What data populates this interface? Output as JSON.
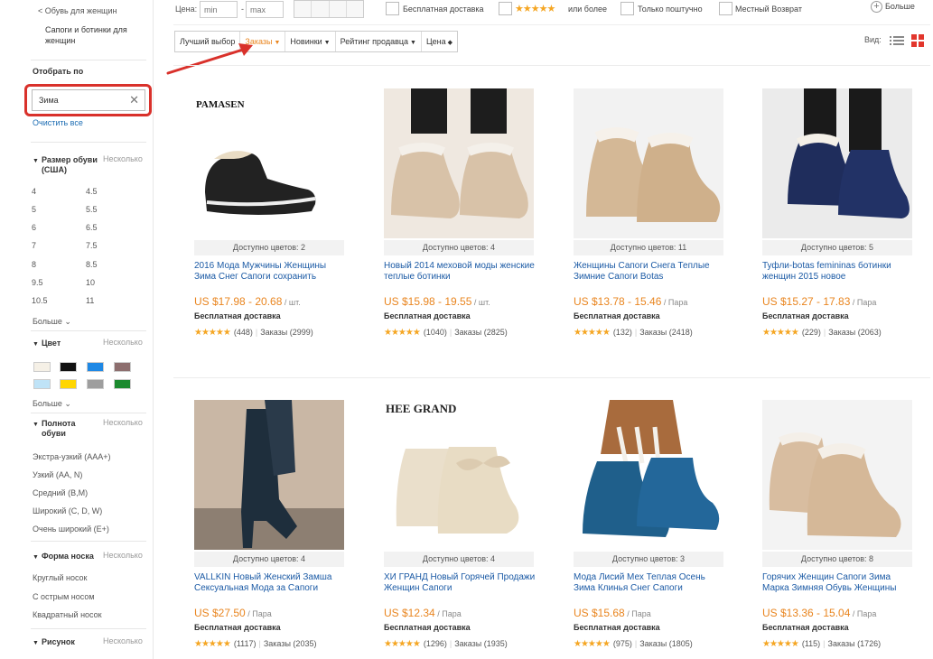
{
  "sidebar": {
    "back_link": "< Обувь для женщин",
    "category": "Сапоги и ботинки для женщин",
    "filter_title": "Отобрать по",
    "search_value": "Зима",
    "clear_all": "Очистить все",
    "multi_label": "Несколько",
    "size_section": "Размер обуви (США)",
    "sizes_left": [
      "4",
      "5",
      "6",
      "7",
      "8",
      "9.5",
      "10.5"
    ],
    "sizes_right": [
      "4.5",
      "5.5",
      "6.5",
      "7.5",
      "8.5",
      "10",
      "11"
    ],
    "more": "Больше",
    "color_section": "Цвет",
    "colors": [
      "#f5f0e6",
      "#111111",
      "#1e88e5",
      "#8d6e6e",
      "#bfe3f7",
      "#ffd600",
      "#9e9e9e",
      "#1b8a2e"
    ],
    "width_section": "Полнота обуви",
    "widths": [
      "Экстра-узкий (AAA+)",
      "Узкий (AA, N)",
      "Средний (B,M)",
      "Широкий (C, D, W)",
      "Очень широкий (E+)"
    ],
    "toe_section": "Форма носка",
    "toes": [
      "Круглый носок",
      "С острым носом",
      "Квадратный носок"
    ],
    "pattern_section": "Рисунок"
  },
  "topbar": {
    "price_label": "Цена:",
    "min_placeholder": "min",
    "max_placeholder": "max",
    "free_shipping": "Бесплатная доставка",
    "rating_or_more": "или более",
    "single_only": "Только поштучно",
    "local_return": "Местный Возврат",
    "more": "Больше"
  },
  "sort": {
    "items": [
      {
        "label": "Лучший выбор"
      },
      {
        "label": "Заказы"
      },
      {
        "label": "Новинки"
      },
      {
        "label": "Рейтинг продавца"
      },
      {
        "label": "Цена"
      }
    ],
    "view_label": "Вид:"
  },
  "products": [
    {
      "colors": "Доступно цветов: 2",
      "title": "2016 Мода Мужчины Женщины Зима Снег Сапоги сохранить",
      "price": "US $17.98 - 20.68",
      "unit": " / шт.",
      "shipping": "Бесплатная доставка",
      "reviews": "(448)",
      "orders": "Заказы (2999)",
      "brand": "PAMASEN"
    },
    {
      "colors": "Доступно цветов: 4",
      "title": "Новый 2014 меховой моды женские теплые ботинки",
      "price": "US $15.98 - 19.55",
      "unit": " / шт.",
      "shipping": "Бесплатная доставка",
      "reviews": "(1040)",
      "orders": "Заказы (2825)",
      "brand": ""
    },
    {
      "colors": "Доступно цветов: 11",
      "title": "Женщины Сапоги Снега Теплые Зимние Сапоги Botas",
      "price": "US $13.78 - 15.46",
      "unit": " / Пара",
      "shipping": "Бесплатная доставка",
      "reviews": "(132)",
      "orders": "Заказы (2418)",
      "brand": ""
    },
    {
      "colors": "Доступно цветов: 5",
      "title": "Туфли-botas femininas ботинки женщин 2015 новое",
      "price": "US $15.27 - 17.83",
      "unit": " / Пара",
      "shipping": "Бесплатная доставка",
      "reviews": "(229)",
      "orders": "Заказы (2063)",
      "brand": ""
    },
    {
      "colors": "Доступно цветов: 4",
      "title": "VALLKIN Новый Женский Замша Сексуальная Мода за Сапоги",
      "price": "US $27.50",
      "unit": " / Пара",
      "shipping": "Бесплатная доставка",
      "reviews": "(1117)",
      "orders": "Заказы (2035)",
      "brand": ""
    },
    {
      "colors": "Доступно цветов: 4",
      "title": "ХИ ГРАНД Новый Горячей Продажи Женщин Сапоги",
      "price": "US $12.34",
      "unit": " / Пара",
      "shipping": "Бесплатная доставка",
      "reviews": "(1296)",
      "orders": "Заказы (1935)",
      "brand": "HEE GRAND"
    },
    {
      "colors": "Доступно цветов: 3",
      "title": "Мода Лисий Мех Теплая Осень Зима Клинья Снег Сапоги",
      "price": "US $15.68",
      "unit": " / Пара",
      "shipping": "Бесплатная доставка",
      "reviews": "(975)",
      "orders": "Заказы (1805)",
      "brand": ""
    },
    {
      "colors": "Доступно цветов: 8",
      "title": "Горячих Женщин Сапоги Зима Марка Зимняя Обувь Женщины",
      "price": "US $13.36 - 15.04",
      "unit": " / Пара",
      "shipping": "Бесплатная доставка",
      "reviews": "(115)",
      "orders": "Заказы (1726)",
      "brand": ""
    }
  ],
  "stars": "★★★★★",
  "accent": "#e9851f",
  "link_color": "#1b5aa5",
  "highlight_color": "#d9312b"
}
